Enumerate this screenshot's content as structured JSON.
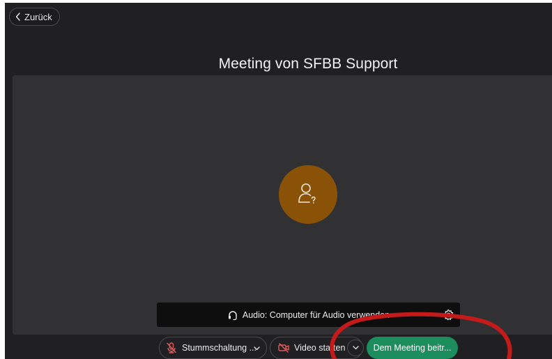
{
  "nav": {
    "back_label": "Zurück",
    "back_icon": "chevron-left-icon"
  },
  "meeting": {
    "title": "Meeting von SFBB Support"
  },
  "preview": {
    "avatar_icon": "unknown-user-icon",
    "avatar_color": "#8a5207",
    "background_color": "#313134"
  },
  "audio": {
    "label": "Audio: Computer für Audio verwenden",
    "icon": "headset-icon",
    "settings_icon": "gear-icon"
  },
  "controls": {
    "mute_label": "Stummschaltung ...",
    "mute_icon": "microphone-muted-icon",
    "video_label": "Video starten",
    "video_icon": "camera-off-icon",
    "join_label": "Dem Meeting beitr...",
    "join_color": "#1c8d5d",
    "muted_icon_color": "#e05a5a"
  },
  "annotation": {
    "shape": "ellipse",
    "color": "#c41a1a",
    "target": "join-meeting-button"
  }
}
